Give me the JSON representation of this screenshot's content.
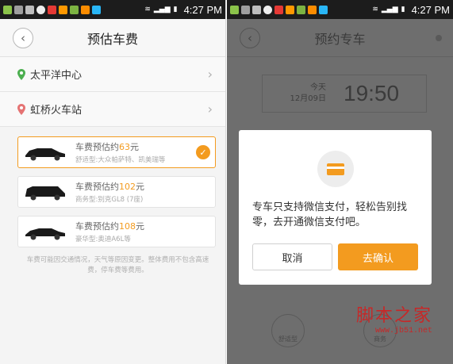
{
  "status_bar": {
    "time": "4:27 PM"
  },
  "left": {
    "title": "预估车费",
    "origin": "太平洋中心",
    "destination": "虹桥火车站",
    "cars": [
      {
        "price_prefix": "车费预估约",
        "price": "63",
        "unit": "元",
        "desc": "舒适型:大众帕萨特、凯美瑞等",
        "selected": true
      },
      {
        "price_prefix": "车费预估约",
        "price": "102",
        "unit": "元",
        "desc": "商务型:别克GL8 (7座)",
        "selected": false
      },
      {
        "price_prefix": "车费预估约",
        "price": "108",
        "unit": "元",
        "desc": "豪华型:奥迪A6L等",
        "selected": false
      }
    ],
    "footnote": "车费可能因交通情况，天气等原因变更。整体费用不包含高速费，停车费等费用。"
  },
  "right": {
    "title": "预约专车",
    "day": "今天",
    "date": "12月09日",
    "time": "19:50",
    "dialog": {
      "message": "专车只支持微信支付，轻松告别找零，去开通微信支付吧。",
      "cancel": "取消",
      "confirm": "去确认"
    },
    "bottom_options": [
      "舒适型",
      "商务"
    ]
  },
  "watermark": {
    "main": "脚本之家",
    "sub": "www.jb51.net"
  },
  "colors": {
    "accent": "#f39b1f",
    "overlay": "#6e6e6e"
  }
}
